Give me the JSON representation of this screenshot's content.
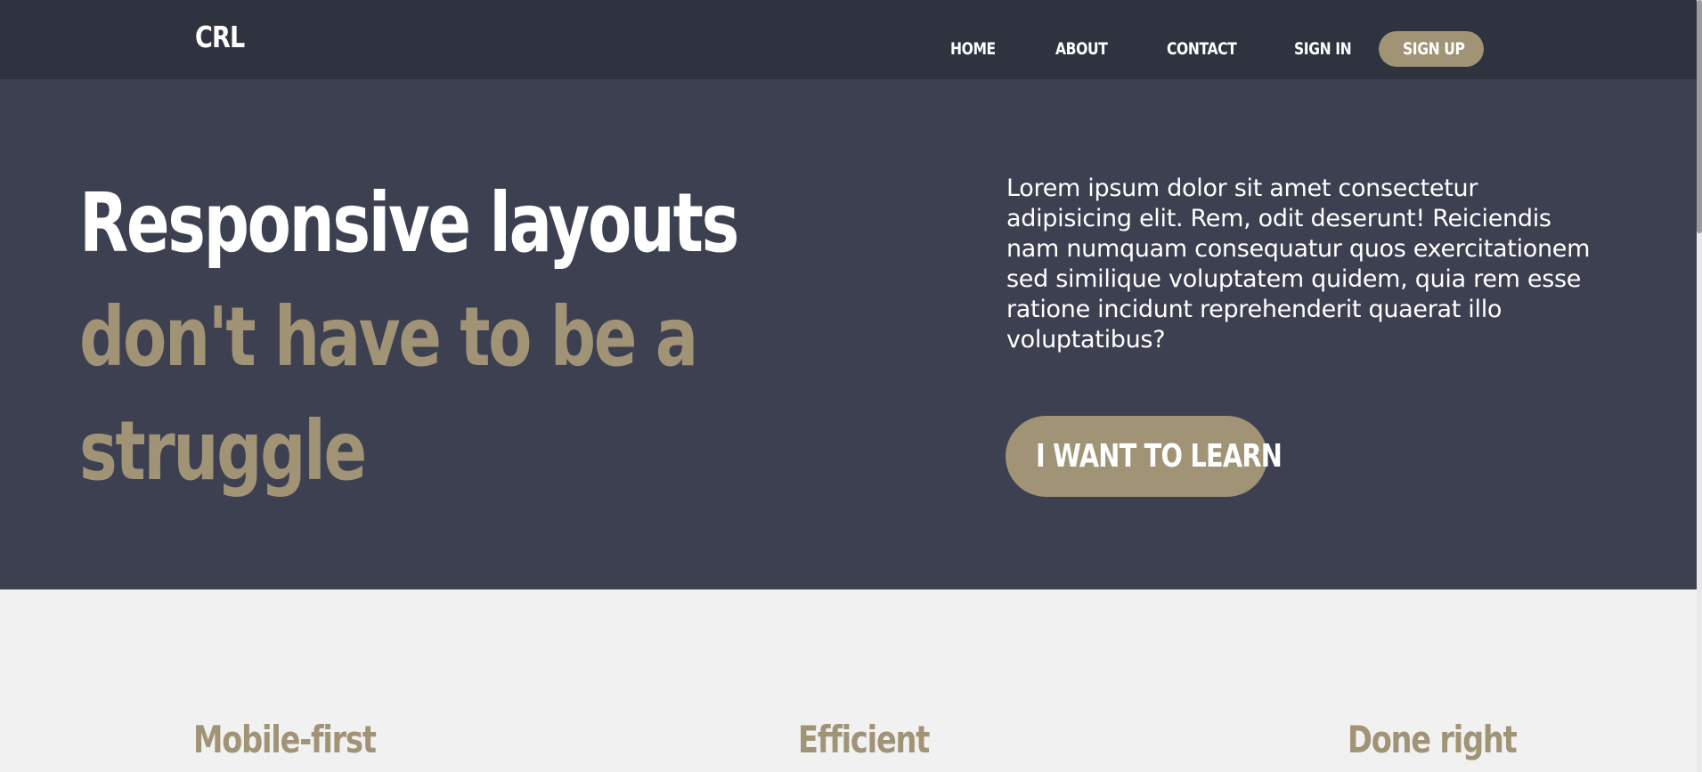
{
  "navbar": {
    "logo": "CRL",
    "links": [
      "HOME",
      "ABOUT",
      "CONTACT",
      "SIGN IN"
    ],
    "signup": "SIGN UP"
  },
  "hero": {
    "headline_line1": "Responsive layouts",
    "headline_line2": "don't have to be a",
    "headline_line3": "struggle",
    "text": "Lorem ipsum dolor sit amet consectetur adipisicing elit. Rem, odit deserunt! Reiciendis nam numquam consequatur quos exercitationem sed similique voluptatem quidem, quia rem esse ratione incidunt reprehenderit quaerat illo voluptatibus?",
    "cta": "I WANT TO LEARN"
  },
  "features": {
    "items": [
      "Mobile-first",
      "Efficient",
      "Done right"
    ]
  },
  "colors": {
    "nav_bg": "#2f3340",
    "hero_bg": "#3c4051",
    "accent": "#a19375",
    "page_bg": "#f1f1f1"
  }
}
